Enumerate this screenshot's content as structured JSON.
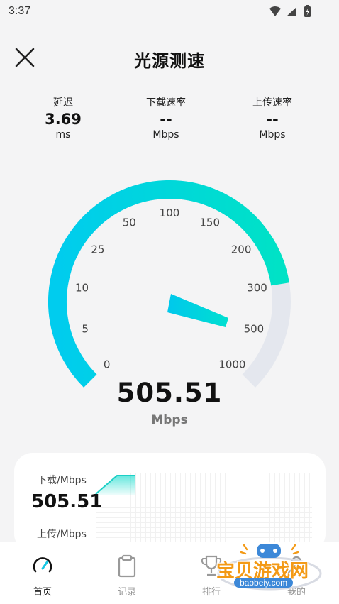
{
  "status_bar": {
    "time": "3:37",
    "icons": [
      "wifi-icon",
      "signal-icon",
      "battery-icon"
    ]
  },
  "header": {
    "title": "光源测速",
    "close_icon": "close-icon"
  },
  "stats": [
    {
      "label": "延迟",
      "value": "3.69",
      "unit": "ms"
    },
    {
      "label": "下载速率",
      "value": "--",
      "unit": "Mbps"
    },
    {
      "label": "上传速率",
      "value": "--",
      "unit": "Mbps"
    }
  ],
  "gauge": {
    "ticks": [
      "0",
      "5",
      "10",
      "25",
      "50",
      "100",
      "150",
      "200",
      "300",
      "500",
      "1000"
    ],
    "current_value": 505.51,
    "fill_fraction": 0.8,
    "colors": {
      "start": "#00ccee",
      "end": "#00e2c6",
      "track": "#e4e7ee"
    }
  },
  "speed": {
    "value": "505.51",
    "unit": "Mbps"
  },
  "results_card": {
    "download_label": "下载/Mbps",
    "download_value": "505.51",
    "upload_label": "上传/Mbps"
  },
  "nav": [
    {
      "label": "首页",
      "icon": "speedometer-icon",
      "active": true
    },
    {
      "label": "记录",
      "icon": "clipboard-icon",
      "active": false
    },
    {
      "label": "排行",
      "icon": "trophy-icon",
      "active": false
    },
    {
      "label": "我的",
      "icon": "user-icon",
      "active": false
    }
  ],
  "watermark": {
    "main": "宝贝游戏网",
    "sub": "baobeiy.com"
  }
}
